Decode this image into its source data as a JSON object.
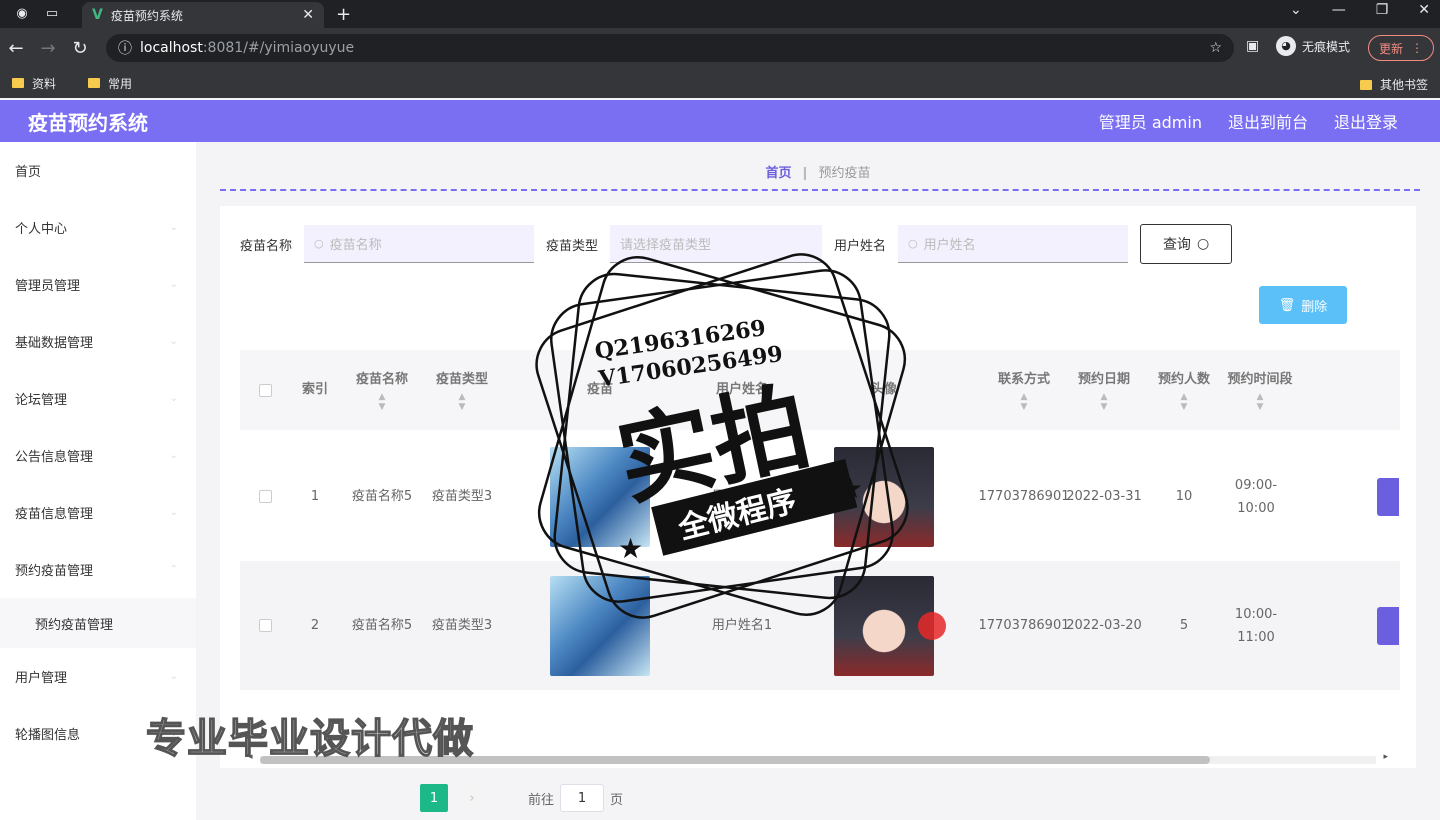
{
  "browser": {
    "tab_title": "疫苗预约系统",
    "url_host": "localhost",
    "url_path": ":8081/#/yimiaoyuyue",
    "incognito_label": "无痕模式",
    "update_label": "更新",
    "bookmarks": [
      "资料",
      "常用"
    ],
    "other_bookmarks": "其他书签"
  },
  "header": {
    "title": "疫苗预约系统",
    "admin_label": "管理员 admin",
    "front_link": "退出到前台",
    "logout_link": "退出登录"
  },
  "sidebar": {
    "items": [
      "首页",
      "个人中心",
      "管理员管理",
      "基础数据管理",
      "论坛管理",
      "公告信息管理",
      "疫苗信息管理",
      "预约疫苗管理"
    ],
    "sub_item": "预约疫苗管理",
    "items_after": [
      "用户管理",
      "轮播图信息"
    ]
  },
  "breadcrumb": {
    "home": "首页",
    "current": "预约疫苗"
  },
  "filters": {
    "name_label": "疫苗名称",
    "name_placeholder": "疫苗名称",
    "type_label": "疫苗类型",
    "type_placeholder": "请选择疫苗类型",
    "user_label": "用户姓名",
    "user_placeholder": "用户姓名",
    "query_button": "查询"
  },
  "delete_button": "删除",
  "table": {
    "columns": [
      "索引",
      "疫苗名称",
      "疫苗类型",
      "疫苗",
      "用户姓名",
      "头像",
      "联系方式",
      "预约日期",
      "预约人数",
      "预约时间段"
    ],
    "rows": [
      {
        "index": "1",
        "name": "疫苗名称5",
        "type": "疫苗类型3",
        "user": "用户姓名1",
        "phone": "17703786901",
        "date": "2022-03-31",
        "count": "10",
        "slot": "09:00-10:00"
      },
      {
        "index": "2",
        "name": "疫苗名称5",
        "type": "疫苗类型3",
        "user": "用户姓名1",
        "phone": "17703786901",
        "date": "2022-03-20",
        "count": "5",
        "slot": "10:00-11:00"
      }
    ]
  },
  "pager": {
    "current_page": "1",
    "goto_label": "前往",
    "page_unit": "页",
    "goto_value": "1"
  },
  "watermark": {
    "contact_q": "Q2196316269",
    "contact_v": "V17060256499",
    "big_text": "实拍",
    "ribbon_text": "全微程序",
    "footer_text": "专业毕业设计代做"
  }
}
